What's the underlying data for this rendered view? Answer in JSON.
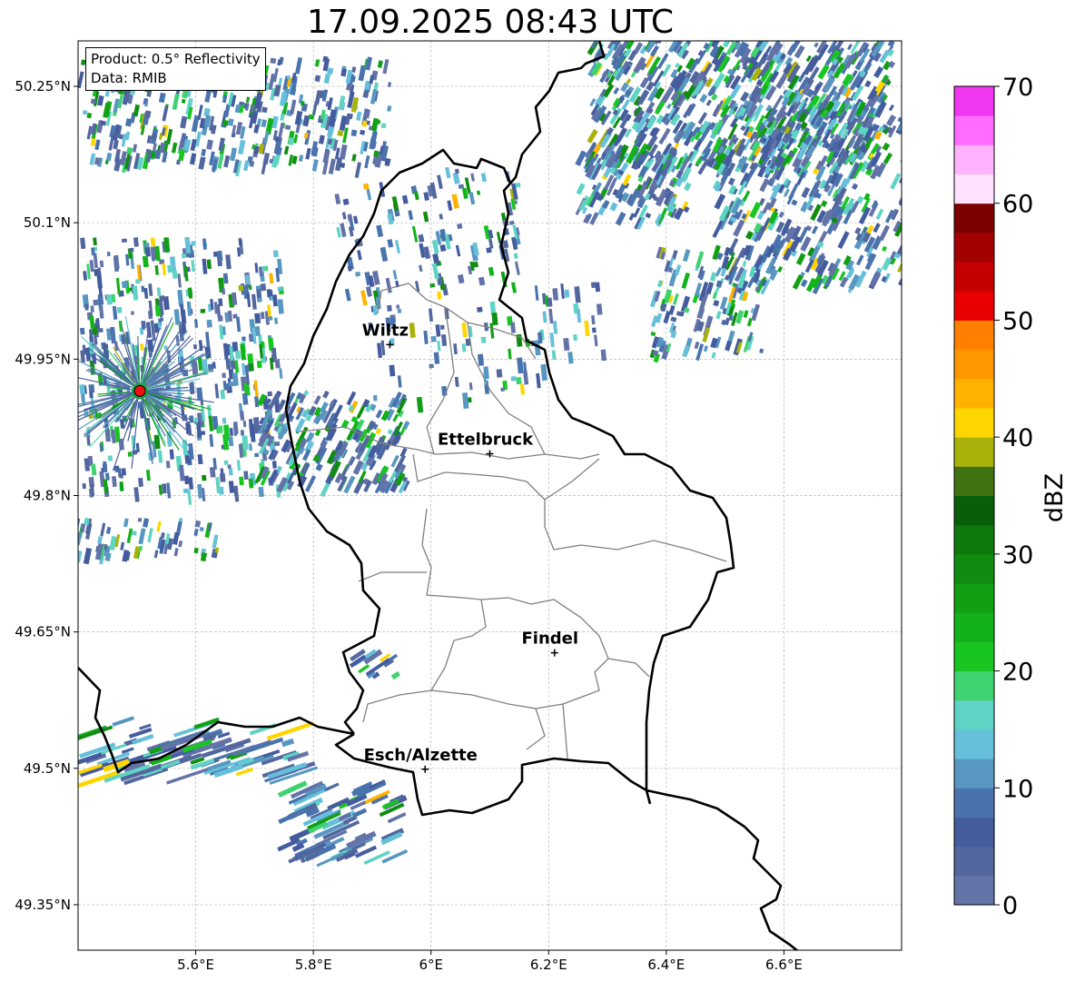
{
  "title": "17.09.2025 08:43 UTC",
  "info": {
    "product": "Product: 0.5° Reflectivity",
    "data": "Data: RMIB"
  },
  "axes": {
    "lon_ticks": [
      "5.6°E",
      "5.8°E",
      "6°E",
      "6.2°E",
      "6.4°E",
      "6.6°E"
    ],
    "lat_ticks": [
      "50.25°N",
      "50.1°N",
      "49.95°N",
      "49.8°N",
      "49.65°N",
      "49.5°N",
      "49.35°N"
    ],
    "lon_range": [
      5.4,
      6.8
    ],
    "lat_range": [
      49.3,
      50.3
    ]
  },
  "cities": [
    {
      "name": "Wiltz",
      "lon": 5.93,
      "lat": 49.966
    },
    {
      "name": "Ettelbruck",
      "lon": 6.1,
      "lat": 49.846
    },
    {
      "name": "Findel",
      "lon": 6.21,
      "lat": 49.627
    },
    {
      "name": "Esch/Alzette",
      "lon": 5.99,
      "lat": 49.499
    }
  ],
  "radar_site": {
    "lon": 5.505,
    "lat": 49.915,
    "color": "#ee1111"
  },
  "colorbar": {
    "label": "dBZ",
    "ticks": [
      "0",
      "10",
      "20",
      "30",
      "40",
      "50",
      "60",
      "70"
    ],
    "range": [
      0,
      70
    ],
    "colors": [
      "#6373a8",
      "#53679f",
      "#445c9e",
      "#4a73ad",
      "#5897c1",
      "#66c0da",
      "#5fd3c4",
      "#3fd36f",
      "#18c521",
      "#13b21a",
      "#119f14",
      "#108d10",
      "#0f780c",
      "#095f09",
      "#417212",
      "#a9b20a",
      "#ffd500",
      "#ffb300",
      "#ff9800",
      "#ff7f00",
      "#e80000",
      "#c40000",
      "#a30000",
      "#7a0000",
      "#ffe2ff",
      "#ffb3ff",
      "#ff6cff",
      "#ee37ee"
    ]
  }
}
